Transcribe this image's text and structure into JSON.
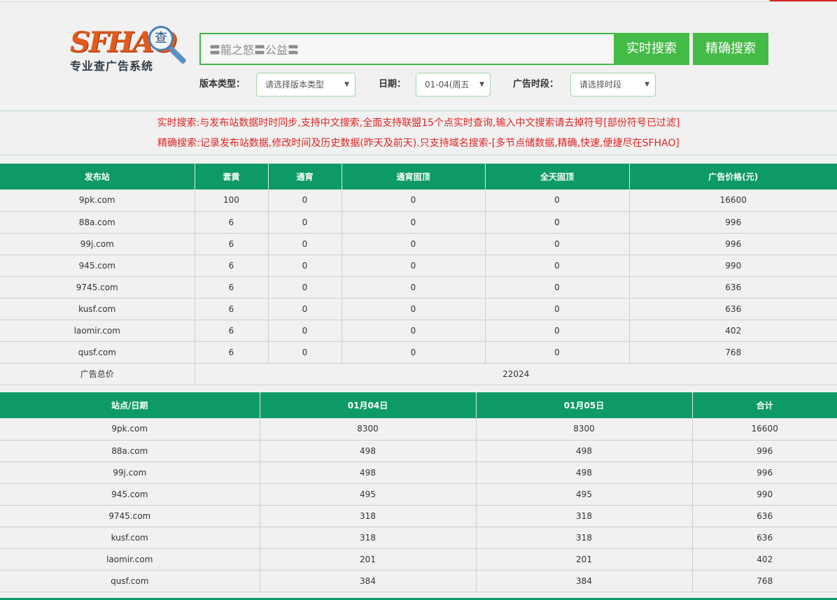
{
  "logo": {
    "main_text": "SFHAO",
    "lens_char": "查",
    "sub_text": "专业查广告系统"
  },
  "search": {
    "value": "〓龍之怒〓公益〓",
    "realtime_label": "实时搜索",
    "exact_label": "精确搜索"
  },
  "filters": {
    "version_label": "版本类型：",
    "version_value": "请选择版本类型",
    "date_label": "日期：",
    "date_value": "01-04(周五",
    "slot_label": "广告时段：",
    "slot_value": "请选择时段"
  },
  "notice": {
    "line1": "实时搜索:与发布站数据时时同步,支持中文搜索,全面支持联盟15个点实时查询,输入中文搜索请去掉符号[部份符号已过滤]",
    "line2": "精确搜索:记录发布站数据,修改时间及历史数据(昨天及前天).只支持域名搜索-[多节点储数据,精确,快速,便捷尽在SFHAO]"
  },
  "table1": {
    "headers": [
      "发布站",
      "套黄",
      "通宵",
      "通宵固顶",
      "全天固顶",
      "广告价格(元)"
    ],
    "rows": [
      [
        "9pk.com",
        "100",
        "0",
        "0",
        "0",
        "16600"
      ],
      [
        "88a.com",
        "6",
        "0",
        "0",
        "0",
        "996"
      ],
      [
        "99j.com",
        "6",
        "0",
        "0",
        "0",
        "996"
      ],
      [
        "945.com",
        "6",
        "0",
        "0",
        "0",
        "990"
      ],
      [
        "9745.com",
        "6",
        "0",
        "0",
        "0",
        "636"
      ],
      [
        "kusf.com",
        "6",
        "0",
        "0",
        "0",
        "636"
      ],
      [
        "laomir.com",
        "6",
        "0",
        "0",
        "0",
        "402"
      ],
      [
        "qusf.com",
        "6",
        "0",
        "0",
        "0",
        "768"
      ]
    ],
    "total_label": "广告总价",
    "total_value": "22024"
  },
  "table2": {
    "headers": [
      "站点/日期",
      "01月04日",
      "01月05日",
      "合计"
    ],
    "rows": [
      [
        "9pk.com",
        "8300",
        "8300",
        "16600"
      ],
      [
        "88a.com",
        "498",
        "498",
        "996"
      ],
      [
        "99j.com",
        "498",
        "498",
        "996"
      ],
      [
        "945.com",
        "495",
        "495",
        "990"
      ],
      [
        "9745.com",
        "318",
        "318",
        "636"
      ],
      [
        "kusf.com",
        "318",
        "318",
        "636"
      ],
      [
        "laomir.com",
        "201",
        "201",
        "402"
      ],
      [
        "qusf.com",
        "384",
        "384",
        "768"
      ]
    ]
  }
}
